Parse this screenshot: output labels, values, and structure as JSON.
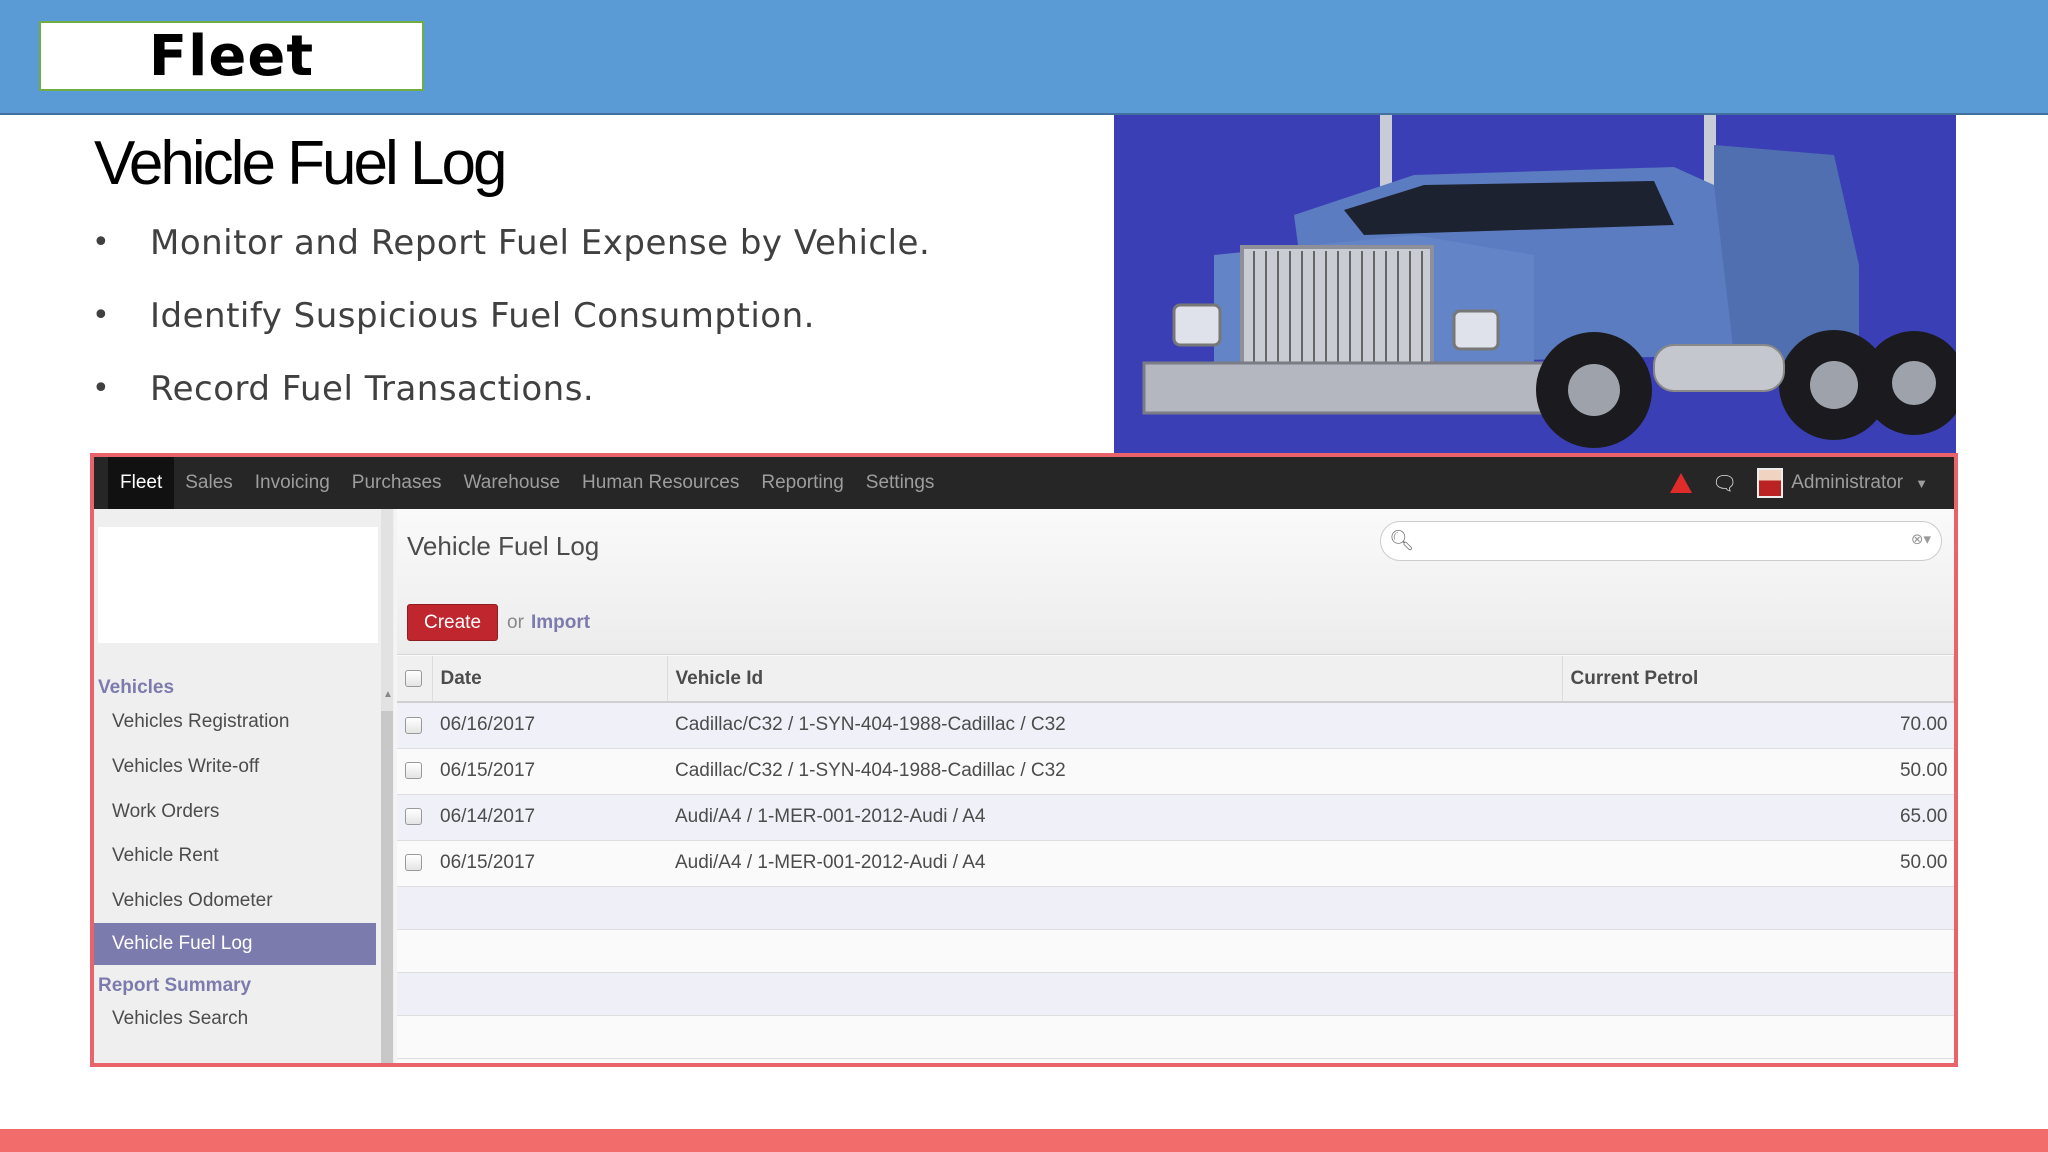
{
  "slide": {
    "title": "Fleet",
    "heading": "Vehicle Fuel Log",
    "bullets": [
      "Monitor and Report Fuel Expense by  Vehicle.",
      "Identify Suspicious Fuel Consumption.",
      "Record Fuel Transactions."
    ],
    "bullet_symbol": "•"
  },
  "colors": {
    "header_band": "#5b9bd5",
    "title_border": "#70ad47",
    "frame_border": "#e8636a",
    "bottom_band": "#f26c6c",
    "accent": "#7c7bad",
    "create_button": "#c0262d"
  },
  "topnav": {
    "menu": [
      "Fleet",
      "Sales",
      "Invoicing",
      "Purchases",
      "Warehouse",
      "Human Resources",
      "Reporting",
      "Settings"
    ],
    "active_menu": "Fleet",
    "icons": [
      "alert-triangle-icon",
      "chat-icon"
    ],
    "user": "Administrator"
  },
  "sidebar": {
    "section_vehicles": "Vehicles",
    "items": [
      "Vehicles Registration",
      "Vehicles Write-off",
      "Work Orders",
      "Vehicle Rent",
      "Vehicles Odometer",
      "Vehicle Fuel Log"
    ],
    "active_item": "Vehicle Fuel Log",
    "section_report": "Report Summary",
    "report_items": [
      "Vehicles Search"
    ]
  },
  "main": {
    "title": "Vehicle Fuel Log",
    "search_value": "",
    "create_label": "Create",
    "or_label": "or",
    "import_label": "Import",
    "columns": [
      "Date",
      "Vehicle Id",
      "Current Petrol"
    ],
    "rows": [
      {
        "date": "06/16/2017",
        "vehicle": "Cadillac/C32 / 1-SYN-404-1988-Cadillac / C32",
        "petrol": "70.00"
      },
      {
        "date": "06/15/2017",
        "vehicle": "Cadillac/C32 / 1-SYN-404-1988-Cadillac / C32",
        "petrol": "50.00"
      },
      {
        "date": "06/14/2017",
        "vehicle": "Audi/A4 / 1-MER-001-2012-Audi / A4",
        "petrol": "65.00"
      },
      {
        "date": "06/15/2017",
        "vehicle": "Audi/A4 / 1-MER-001-2012-Audi / A4",
        "petrol": "50.00"
      }
    ]
  }
}
